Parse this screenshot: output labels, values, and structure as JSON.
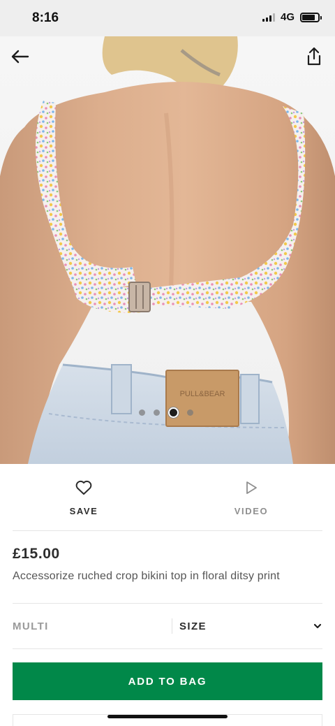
{
  "status_bar": {
    "time": "8:16",
    "network": "4G",
    "battery_level": 0.8
  },
  "gallery": {
    "image_count": 4,
    "active_index": 2,
    "brand_tag_text": "PULL&BEAR"
  },
  "actions": {
    "save_label": "SAVE",
    "video_label": "VIDEO"
  },
  "product": {
    "price": "£15.00",
    "title": "Accessorize ruched crop bikini top in floral ditsy print"
  },
  "selectors": {
    "colour_value": "MULTI",
    "size_label": "SIZE"
  },
  "cta": {
    "add_to_bag_label": "ADD TO BAG"
  },
  "colors": {
    "accent_green": "#018849",
    "status_bar_bg": "#eeeeee",
    "text_primary": "#2d2d2d",
    "text_muted": "#9a9a9a"
  },
  "icons": [
    "back-arrow-icon",
    "share-icon",
    "heart-icon",
    "play-icon",
    "chevron-down-icon"
  ]
}
